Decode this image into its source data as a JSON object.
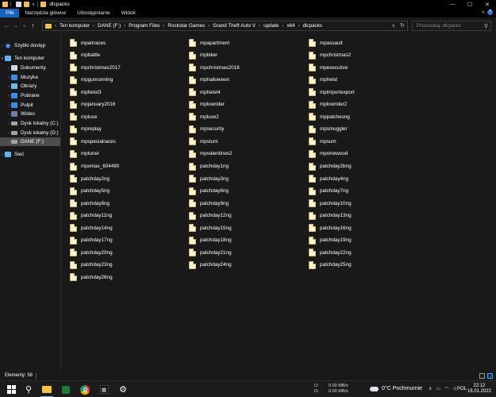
{
  "window": {
    "title": "dlcpacks",
    "controls": {
      "minimize": "—",
      "maximize": "☐",
      "close": "✕"
    }
  },
  "ribbon": {
    "tabs": [
      "Plik",
      "Narzędzia główne",
      "Udostępnianie",
      "Widok"
    ],
    "active_tab": "Plik"
  },
  "address_bar": {
    "breadcrumbs": [
      "Ten komputer",
      "DANE (F:)",
      "Program Files",
      "Rockstar Games",
      "Grand Theft Auto V",
      "update",
      "x64",
      "dlcpacks"
    ],
    "separator": "›"
  },
  "search": {
    "placeholder": "Przeszukaj: dlcpacks"
  },
  "sidebar": {
    "items": [
      {
        "label": "Szybki dostęp",
        "icon": "star-icon",
        "color": "#4aa3ff",
        "level": 0
      },
      {
        "label": "Ten komputer",
        "icon": "computer-icon",
        "color": "#5fb2f5",
        "level": 0
      },
      {
        "label": "Dokumenty",
        "icon": "documents-icon",
        "color": "#cfd8e3",
        "level": 1
      },
      {
        "label": "Muzyka",
        "icon": "music-icon",
        "color": "#3b8ee8",
        "level": 1
      },
      {
        "label": "Obrazy",
        "icon": "pictures-icon",
        "color": "#6fb9e8",
        "level": 1
      },
      {
        "label": "Pobrane",
        "icon": "downloads-icon",
        "color": "#3b8ee8",
        "level": 1
      },
      {
        "label": "Pulpit",
        "icon": "desktop-icon",
        "color": "#3b8ee8",
        "level": 1
      },
      {
        "label": "Wideo",
        "icon": "video-icon",
        "color": "#6a7fa8",
        "level": 1
      },
      {
        "label": "Dysk lokalny (C:)",
        "icon": "drive-icon",
        "color": "#9aa6b2",
        "level": 1
      },
      {
        "label": "Dysk lokalny (D:)",
        "icon": "drive-icon",
        "color": "#9aa6b2",
        "level": 1
      },
      {
        "label": "DANE (F:)",
        "icon": "drive-icon",
        "color": "#9aa6b2",
        "level": 1,
        "selected": true
      },
      {
        "label": "Sieć",
        "icon": "network-icon",
        "color": "#5fb2f5",
        "level": 0
      }
    ]
  },
  "files": {
    "columns": [
      [
        "mpairraces",
        "mpbattle",
        "mpchristmas2017",
        "mpgunrunning",
        "mpheist3",
        "mpjanuary2016",
        "mpluxe",
        "mpreplay",
        "mpspecialraces",
        "mptuner",
        "mpxmas_604490",
        "patchday2ng",
        "patchday5ng",
        "patchday8ng",
        "patchday11ng",
        "patchday14ng",
        "patchday17ng",
        "patchday20ng",
        "patchday23ng",
        "patchday26ng"
      ],
      [
        "mpapartment",
        "mpbiker",
        "mpchristmas2018",
        "mphalloween",
        "mpheist4",
        "mplowrider",
        "mpluxe2",
        "mpsecurity",
        "mpstunt",
        "mpvalentines2",
        "patchday1ng",
        "patchday3ng",
        "patchday6ng",
        "patchday9ng",
        "patchday12ng",
        "patchday15ng",
        "patchday18ng",
        "patchday21ng",
        "patchday24ng"
      ],
      [
        "mpassault",
        "mpchristmas2",
        "mpexecutive",
        "mpheist",
        "mpimportexport",
        "mplowrider2",
        "mppatchesng",
        "mpsmuggler",
        "mpsum",
        "mpvinewood",
        "patchday2bng",
        "patchday4ng",
        "patchday7ng",
        "patchday10ng",
        "patchday13ng",
        "patchday16ng",
        "patchday19ng",
        "patchday22ng",
        "patchday25ng"
      ]
    ]
  },
  "status": {
    "items_count": "Elementy: 58"
  },
  "taskbar": {
    "network": {
      "up_label": "U:",
      "down_label": "D:",
      "up_speed": "0.00 MB/s",
      "down_speed": "0.00 MB/s"
    },
    "weather": "0°C  Pochmurnie",
    "language": "POL",
    "time": "22:12",
    "date": "16.01.2022"
  }
}
